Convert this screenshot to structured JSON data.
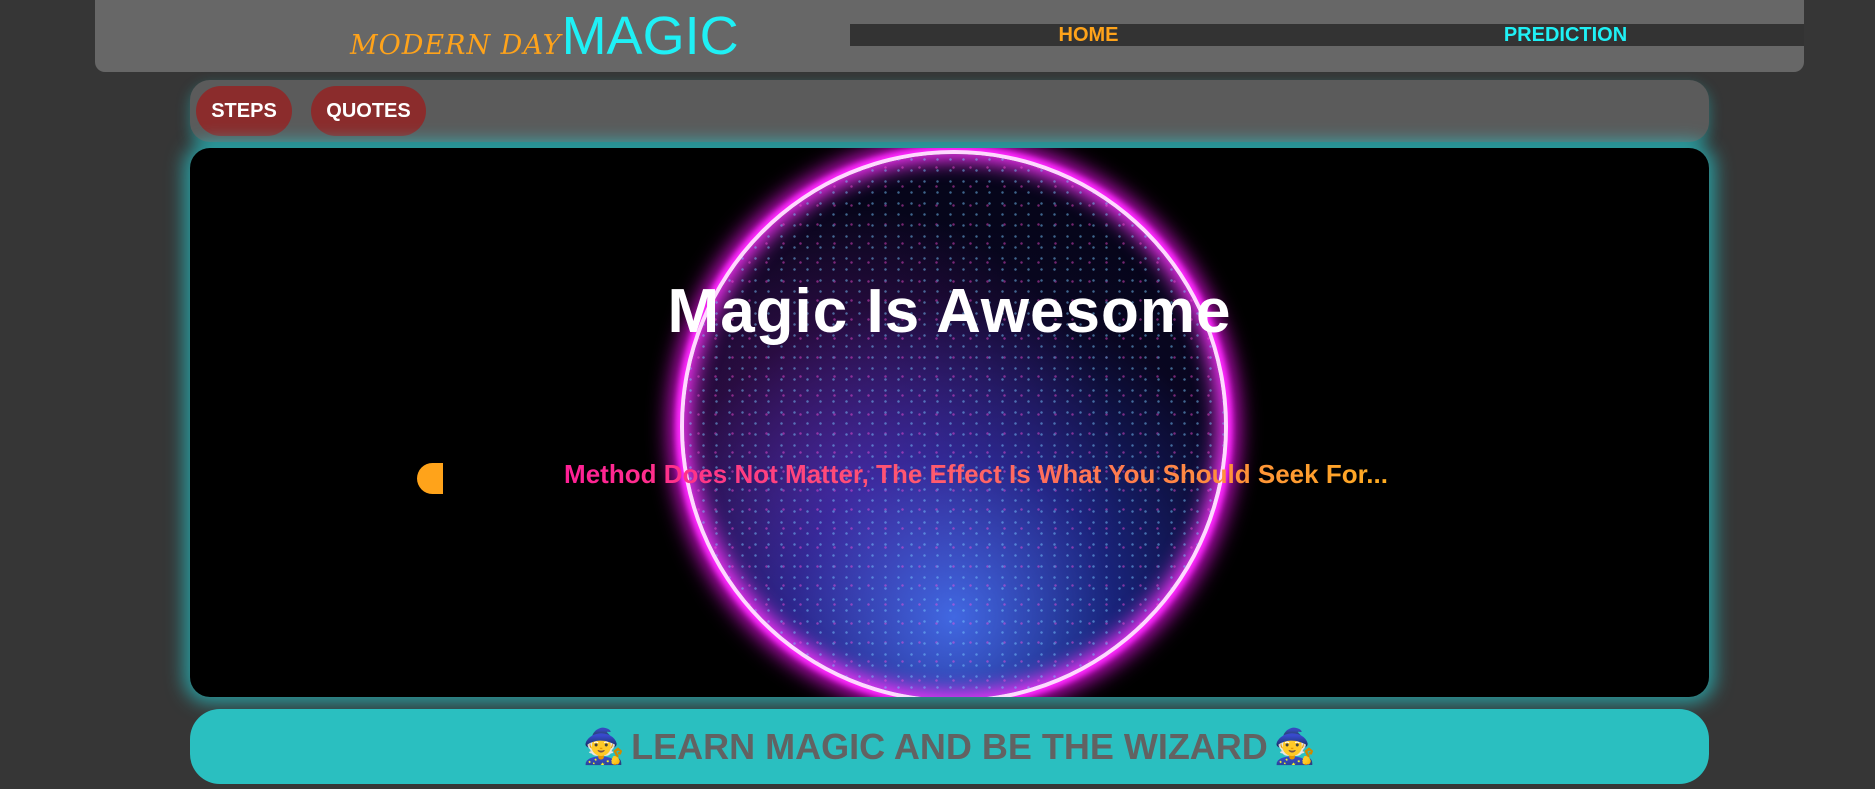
{
  "header": {
    "brand_small": "MODERN DAY",
    "brand_big": "MAGIC",
    "nav": [
      {
        "label": "HOME",
        "color": "#ffa31a"
      },
      {
        "label": "PREDICTION",
        "color": "#1ff0f5"
      }
    ]
  },
  "subnav": {
    "steps_label": "STEPS",
    "quotes_label": "QUOTES"
  },
  "hero": {
    "title": "Magic Is Awesome",
    "subtitle": "Method Does Not Matter, The Effect Is What You Should Seek For...",
    "orb_icon": "magic-orb",
    "cursor_icon": "typing-cursor-icon"
  },
  "cta": {
    "label": "LEARN MAGIC AND BE THE WIZARD",
    "icon": "🧙",
    "icon_name": "wizard-icon"
  },
  "colors": {
    "background": "#363636",
    "header": "#676767",
    "accent_orange": "#ffa31a",
    "accent_cyan": "#1ff0f5",
    "pill": "#8b2c2c",
    "cta": "#2abfc0"
  }
}
